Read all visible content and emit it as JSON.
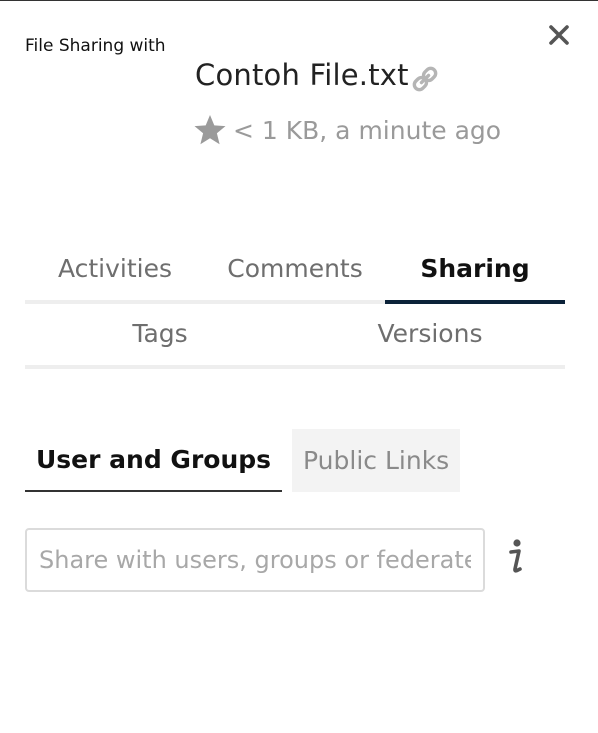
{
  "header": {
    "label": "File Sharing with",
    "close_icon": "close-icon"
  },
  "file": {
    "name": "Contoh File.txt",
    "link_icon": "link-icon",
    "star_icon": "star-icon",
    "meta": "< 1 KB, a minute ago"
  },
  "tabs": [
    {
      "label": "Activities",
      "active": false
    },
    {
      "label": "Comments",
      "active": false
    },
    {
      "label": "Sharing",
      "active": true
    },
    {
      "label": "Tags",
      "active": false
    },
    {
      "label": "Versions",
      "active": false
    }
  ],
  "sharing": {
    "subtabs": [
      {
        "label": "User and Groups",
        "active": true
      },
      {
        "label": "Public Links",
        "active": false
      }
    ],
    "input_value": "",
    "input_placeholder": "Share with users, groups or federated cloud users",
    "info_icon": "info-icon"
  },
  "colors": {
    "active_tab_underline": "#0b2239",
    "inactive_text": "#6e6e6e",
    "meta_text": "#9a9a9a",
    "icon_gray": "#b5b5b5"
  }
}
